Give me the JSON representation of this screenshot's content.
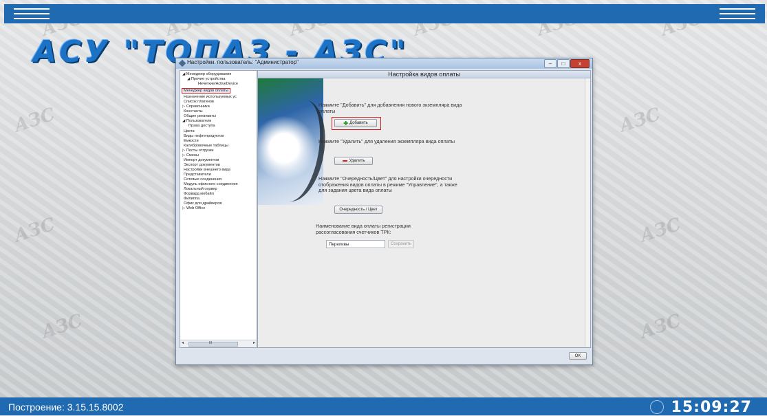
{
  "desktop": {
    "logo": "АСУ \"ТОПАЗ - АЗС\"",
    "watermark": "АЗС",
    "build": "Построение: 3.15.15.8002",
    "clock": "15:09:27"
  },
  "window": {
    "title": "Настройки. пользователь: \"Администратор\"",
    "buttons": {
      "minimize": "–",
      "maximize": "□",
      "close": "x"
    },
    "tree": [
      {
        "label": "◢ Менеджер оборудования"
      },
      {
        "label": "◢ Прочие устройства"
      },
      {
        "label": "Нечеткие/ActiveDevice"
      },
      {
        "label": "Менеджер видов оплаты"
      },
      {
        "label": "Назначение используемых ус"
      },
      {
        "label": "Список плагинов"
      },
      {
        "label": "▷ Справочники"
      },
      {
        "label": "Константы"
      },
      {
        "label": "Общие реквизиты"
      },
      {
        "label": "◢ Пользователи"
      },
      {
        "label": "Права доступа"
      },
      {
        "label": "Цвета"
      },
      {
        "label": "Виды нефтепродуктов"
      },
      {
        "label": "Емкости"
      },
      {
        "label": "Калибровочные таблицы"
      },
      {
        "label": "▷ Посты отгрузки"
      },
      {
        "label": "▷ Смены"
      },
      {
        "label": "Импорт документов"
      },
      {
        "label": "Экспорт документов"
      },
      {
        "label": "Настройки внешнего вида"
      },
      {
        "label": "Представители"
      },
      {
        "label": "Сетевые соединения"
      },
      {
        "label": "Модуль офисного соединения"
      },
      {
        "label": "Локальный сервер"
      },
      {
        "label": "Форвард мобайл"
      },
      {
        "label": "Филиппа"
      },
      {
        "label": "Офис для драйверов"
      },
      {
        "label": "▷ Web Office"
      }
    ],
    "tree_scroll": {
      "left": "◂",
      "right": "▸",
      "thumb": "III"
    },
    "panel": {
      "header": "Настройка видов оплаты",
      "add_hint": "Нажмите \"Добавить\" для добавления нового экземпляра вида оплаты",
      "add_button": "Добавить",
      "delete_hint": "Нажмите \"Удалить\" для удаления экземпляра вида оплаты",
      "delete_button": "Удалить",
      "order_hint": "Нажмите \"Очередность/Цвет\" для настройки очередности отображения видов оплаты в режиме \"Управление\", а также для задания цвета вида оплаты",
      "order_button": "Очередность / Цвет",
      "reg_label": "Наименование вида оплаты регистрации рассогласования счетчиков ТРК:",
      "reg_value": "Переливы",
      "save_button": "Сохранить"
    },
    "ok_button": "OK"
  }
}
